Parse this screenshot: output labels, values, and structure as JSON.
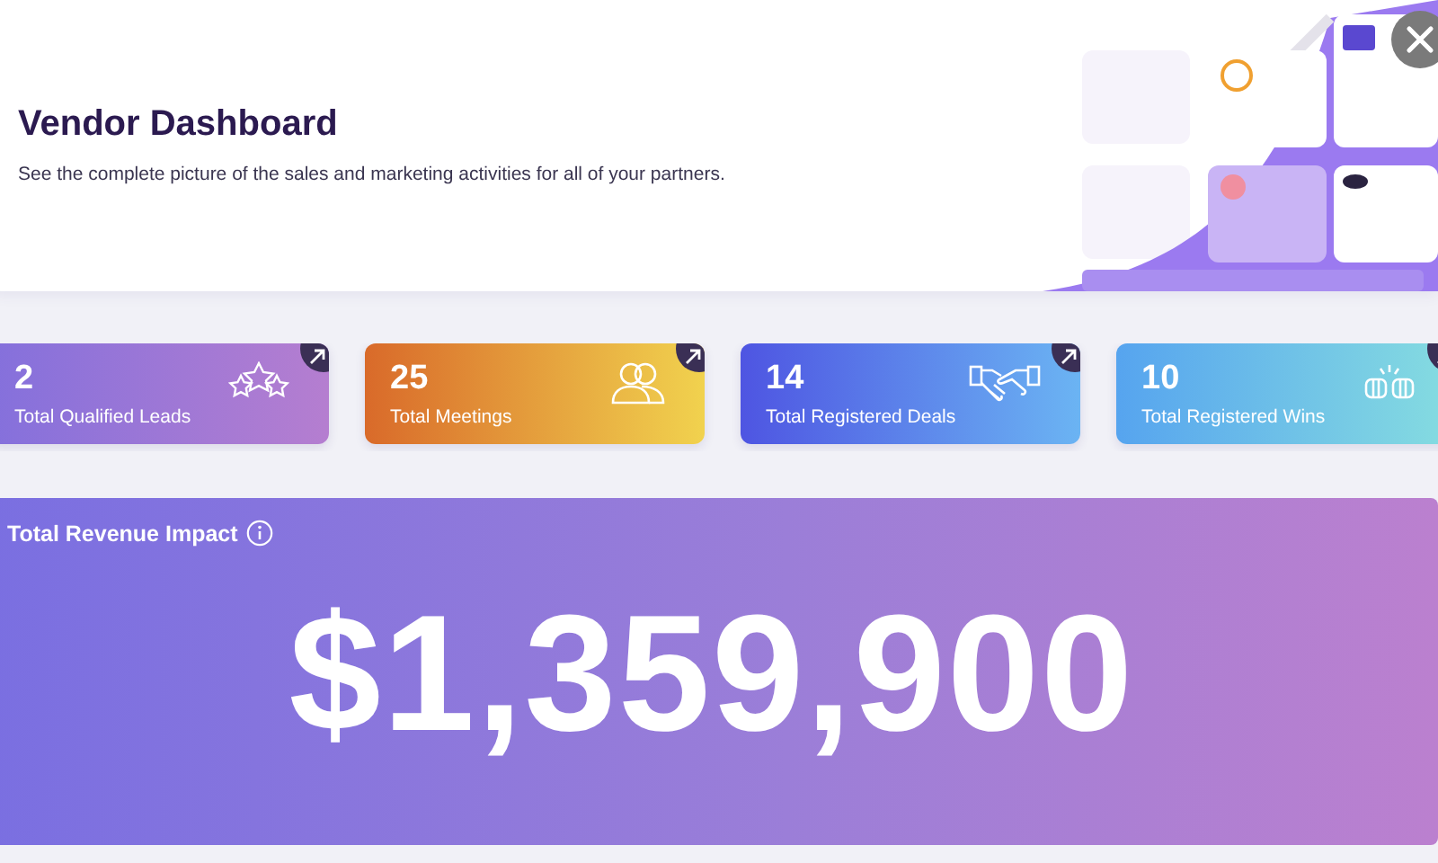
{
  "banner": {
    "title": "Vendor Dashboard",
    "subtitle": "See the complete picture of the sales and marketing activities for all of your partners."
  },
  "stats": [
    {
      "kind": "leads",
      "value": "2",
      "label": "Total Qualified Leads"
    },
    {
      "kind": "meetings",
      "value": "25",
      "label": "Total Meetings"
    },
    {
      "kind": "deals",
      "value": "14",
      "label": "Total Registered Deals"
    },
    {
      "kind": "wins",
      "value": "10",
      "label": "Total Registered Wins"
    }
  ],
  "revenue": {
    "title": "Total Revenue Impact",
    "amount": "$1,359,900"
  }
}
